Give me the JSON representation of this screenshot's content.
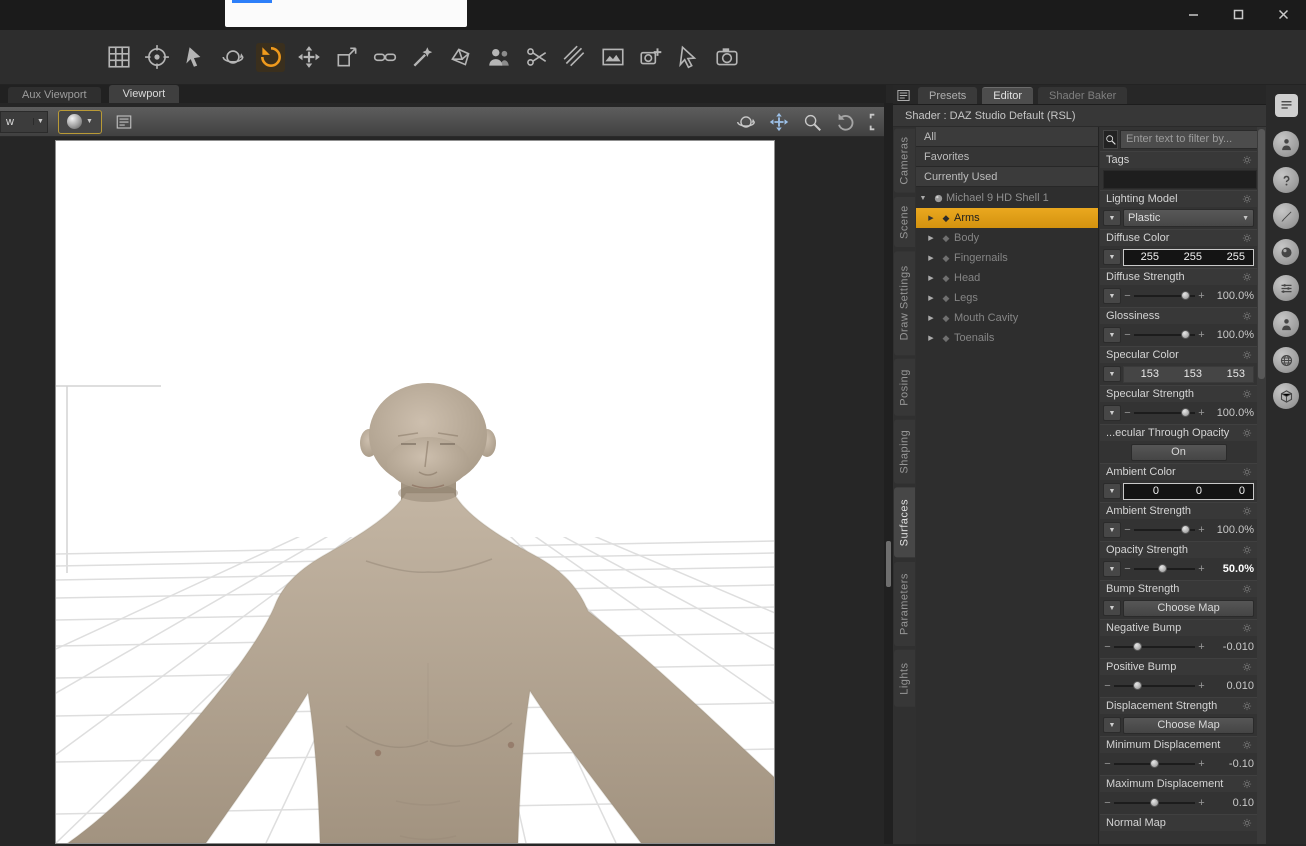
{
  "window": {
    "controls": {
      "minimize": "minimize",
      "restore": "restore",
      "close": "close"
    }
  },
  "toolbar": {
    "tools": [
      {
        "name": "scene-navigator-tool",
        "icon": "grid"
      },
      {
        "name": "highlight-tool",
        "icon": "target"
      },
      {
        "name": "node-selection-tool",
        "icon": "cursor"
      },
      {
        "name": "orbit-select-tool",
        "icon": "orbit"
      },
      {
        "name": "rotate-tool",
        "icon": "rotate",
        "active": true
      },
      {
        "name": "translate-tool",
        "icon": "move"
      },
      {
        "name": "scale-tool",
        "icon": "scale"
      },
      {
        "name": "active-pose-tool",
        "icon": "chain"
      },
      {
        "name": "surface-selection-tool",
        "icon": "wand"
      },
      {
        "name": "geometry-editor-tool",
        "icon": "facet"
      },
      {
        "name": "figure-setup-tool",
        "icon": "people"
      },
      {
        "name": "node-weight-brush-tool",
        "icon": "scissors"
      },
      {
        "name": "weight-map-tool",
        "icon": "hatch"
      },
      {
        "name": "region-editor-tool",
        "icon": "image"
      },
      {
        "name": "spot-render-tool",
        "icon": "cameraplus"
      },
      {
        "name": "aux-pointer-tool",
        "icon": "pointer"
      },
      {
        "name": "render-tool",
        "icon": "camera"
      }
    ]
  },
  "viewport_tabs": [
    {
      "label": "Aux Viewport",
      "active": false
    },
    {
      "label": "Viewport",
      "active": true
    }
  ],
  "viewport": {
    "view_selector": "w",
    "right_tools": [
      {
        "name": "orbit-camera-icon",
        "icon": "orbit",
        "color": "#c9c9c9"
      },
      {
        "name": "pan-camera-icon",
        "icon": "move",
        "color": "#9cc0e8"
      },
      {
        "name": "zoom-camera-icon",
        "icon": "mag",
        "color": "#c9c9c9"
      },
      {
        "name": "undo-view-icon",
        "icon": "undo",
        "color": "#a5a5a5"
      },
      {
        "name": "frame-view-icon",
        "icon": "frame",
        "color": "#c9c9c9"
      }
    ]
  },
  "right_panel": {
    "tabs": [
      {
        "label": "Presets",
        "state": "normal"
      },
      {
        "label": "Editor",
        "state": "active"
      },
      {
        "label": "Shader Baker",
        "state": "disabled"
      }
    ],
    "shader_label": "Shader : DAZ Studio Default (RSL)",
    "filter": {
      "placeholder": "Enter text to filter by..."
    },
    "lists": [
      "All",
      "Favorites",
      "Currently Used"
    ],
    "tree": {
      "root": {
        "label": "Michael 9 HD Shell 1"
      },
      "items": [
        {
          "label": "Arms",
          "selected": true
        },
        {
          "label": "Body"
        },
        {
          "label": "Fingernails"
        },
        {
          "label": "Head"
        },
        {
          "label": "Legs"
        },
        {
          "label": "Mouth Cavity"
        },
        {
          "label": "Toenails"
        }
      ]
    },
    "side_tabs": [
      {
        "label": "Cameras"
      },
      {
        "label": "Scene"
      },
      {
        "label": "Draw Settings"
      },
      {
        "label": "Posing"
      },
      {
        "label": "Shaping"
      },
      {
        "label": "Surfaces",
        "active": true
      },
      {
        "label": "Parameters"
      },
      {
        "label": "Lights"
      }
    ],
    "tags": {
      "label": "Tags",
      "button": "..."
    },
    "properties": [
      {
        "label": "Lighting Model",
        "type": "dropdown",
        "value": "Plastic"
      },
      {
        "label": "Diffuse Color",
        "type": "color",
        "values": [
          "255",
          "255",
          "255"
        ],
        "bordered": true
      },
      {
        "label": "Diffuse Strength",
        "type": "slider",
        "value": "100.0%",
        "pos": 0.85
      },
      {
        "label": "Glossiness",
        "type": "slider",
        "value": "100.0%",
        "pos": 0.85
      },
      {
        "label": "Specular Color",
        "type": "color",
        "values": [
          "153",
          "153",
          "153"
        ],
        "bordered": false
      },
      {
        "label": "Specular Strength",
        "type": "slider",
        "value": "100.0%",
        "pos": 0.85
      },
      {
        "label": "...ecular Through Opacity",
        "type": "button",
        "value": "On"
      },
      {
        "label": "Ambient Color",
        "type": "color",
        "values": [
          "0",
          "0",
          "0"
        ],
        "bordered": true
      },
      {
        "label": "Ambient Strength",
        "type": "slider",
        "value": "100.0%",
        "pos": 0.85
      },
      {
        "label": "Opacity Strength",
        "type": "slider",
        "value": "50.0%",
        "pos": 0.47,
        "highlight": true
      },
      {
        "label": "Bump Strength",
        "type": "map",
        "value": "Choose Map"
      },
      {
        "label": "Negative Bump",
        "type": "numslider",
        "value": "-0.010",
        "pos": 0.3
      },
      {
        "label": "Positive Bump",
        "type": "numslider",
        "value": "0.010",
        "pos": 0.3
      },
      {
        "label": "Displacement Strength",
        "type": "map",
        "value": "Choose Map"
      },
      {
        "label": "Minimum Displacement",
        "type": "numslider",
        "value": "-0.10",
        "pos": 0.5
      },
      {
        "label": "Maximum Displacement",
        "type": "numslider",
        "value": "0.10",
        "pos": 0.5
      },
      {
        "label": "Normal Map",
        "type": "partial"
      }
    ],
    "dock_icons": [
      {
        "name": "pane-list-icon",
        "icon": "lines",
        "shape": "square"
      },
      {
        "name": "smart-content-pane-icon",
        "icon": "person",
        "shape": "circle"
      },
      {
        "name": "help-pane-icon",
        "icon": "question",
        "shape": "circle"
      },
      {
        "name": "shader-mixer-pane-icon",
        "icon": "brush",
        "shape": "circle"
      },
      {
        "name": "surfaces-pane-icon",
        "icon": "ball",
        "shape": "circle"
      },
      {
        "name": "posing-pane-icon",
        "icon": "sliders",
        "shape": "circle"
      },
      {
        "name": "shaping-pane-icon",
        "icon": "person",
        "shape": "circle"
      },
      {
        "name": "environment-pane-icon",
        "icon": "globe",
        "shape": "circle"
      },
      {
        "name": "render-settings-pane-icon",
        "icon": "cube",
        "shape": "circle"
      }
    ]
  },
  "colors": {
    "selection_yellow": "#dfa01a",
    "active_tool_orange": "#ef9a1d",
    "pan_blue": "#9cc0e8"
  }
}
